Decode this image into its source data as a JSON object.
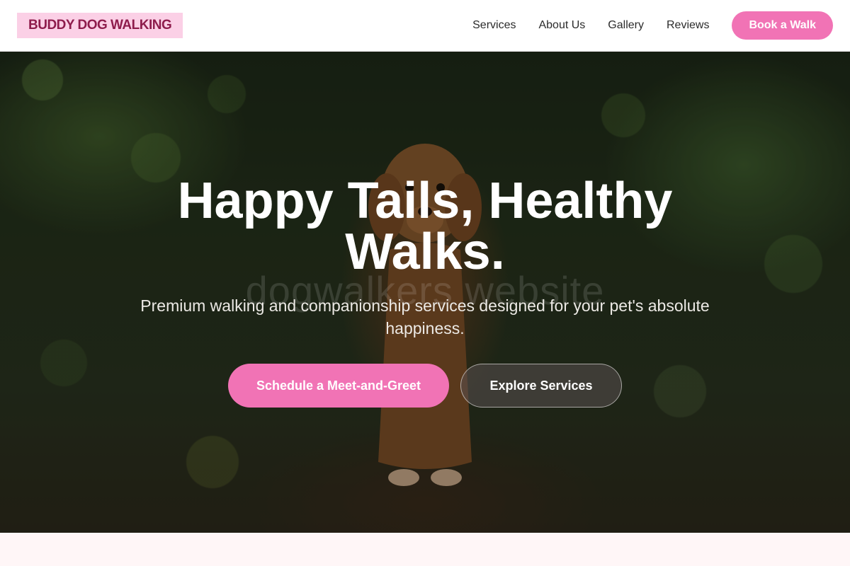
{
  "header": {
    "logo_text": "BUDDY DOG WALKING",
    "nav": [
      {
        "label": "Services"
      },
      {
        "label": "About Us"
      },
      {
        "label": "Gallery"
      },
      {
        "label": "Reviews"
      }
    ],
    "cta_label": "Book a Walk"
  },
  "hero": {
    "title": "Happy Tails, Healthy Walks.",
    "watermark": "dogwalkers website",
    "subtitle": "Premium walking and companionship services designed for your pet's absolute happiness.",
    "primary_button": "Schedule a Meet-and-Greet",
    "secondary_button": "Explore Services",
    "background_subject": "dog-in-forest-photo"
  },
  "colors": {
    "accent_pink": "#f173b5",
    "logo_bg": "#fbd0e6",
    "logo_text": "#8e1c4c",
    "page_bg": "#fff6f7"
  }
}
